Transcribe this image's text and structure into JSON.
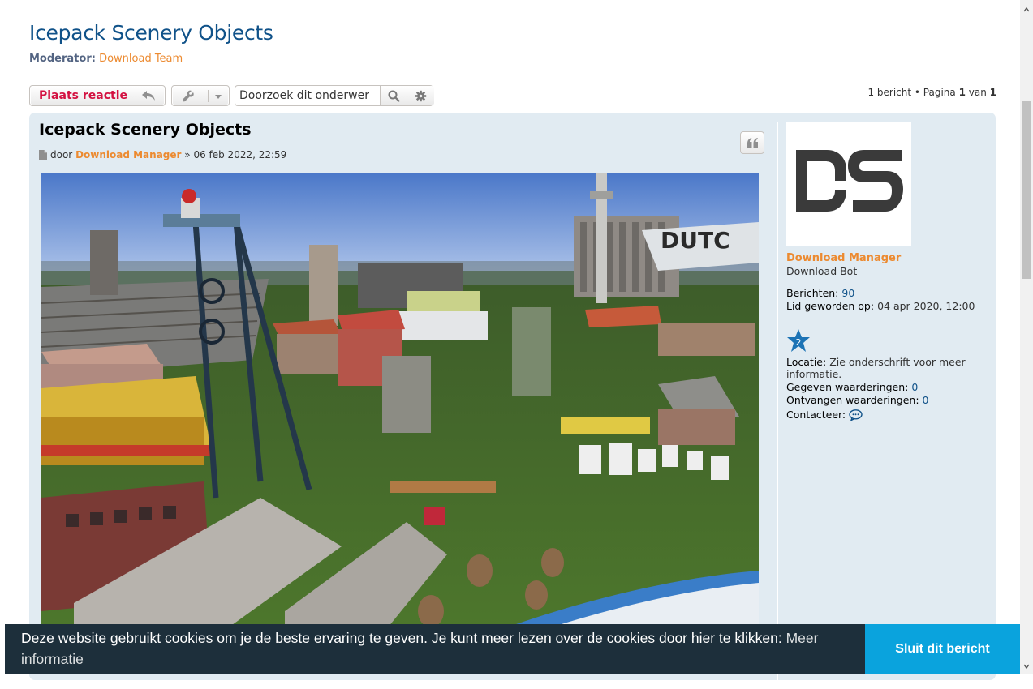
{
  "page": {
    "title": "Icepack Scenery Objects",
    "moderator_label": "Moderator:",
    "moderator_value": "Download Team"
  },
  "action_bar": {
    "reply_label": "Plaats reactie",
    "search_value": "Doorzoek dit onderwer",
    "pagination_prefix": "1 bericht • Pagina ",
    "pagination_current": "1",
    "pagination_mid": " van ",
    "pagination_total": "1"
  },
  "post": {
    "title": "Icepack Scenery Objects",
    "by": "door",
    "author": "Download Manager",
    "date": "» 06 feb 2022, 22:59",
    "image_overlay_text": "DUTC"
  },
  "profile": {
    "avatar_text": "DS",
    "name": "Download Manager",
    "rank": "Download Bot",
    "posts_label": "Berichten:",
    "posts_value": "90",
    "joined_label": "Lid geworden op:",
    "joined_value": "04 apr 2020, 12:00",
    "rank_badge": "2",
    "location_label": "Locatie:",
    "location_value": "Zie onderschrift voor meer informatie.",
    "given_label": "Gegeven waarderingen:",
    "given_value": "0",
    "received_label": "Ontvangen waarderingen:",
    "received_value": "0",
    "contact_label": "Contacteer:"
  },
  "cookie": {
    "text": "Deze website gebruikt cookies om je de beste ervaring te geven. Je kunt meer lezen over de cookies door hier te klikken: ",
    "link": "Meer informatie",
    "button": "Sluit dit bericht"
  },
  "colors": {
    "title_blue": "#105289",
    "accent_orange": "#ec8a30",
    "reply_red": "#d31141",
    "post_bg": "#e1ebf2",
    "cookie_bg": "#1d2f3b",
    "cookie_btn": "#0aa3dd"
  }
}
